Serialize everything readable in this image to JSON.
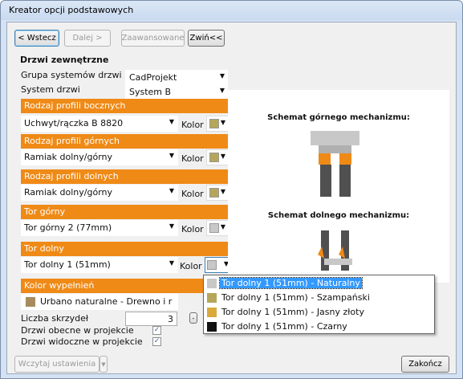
{
  "window": {
    "title": "Kreator opcji podstawowych"
  },
  "toolbar": {
    "back_label": "< Wstecz",
    "next_label": "Dalej >",
    "advanced_label": "Zaawansowane",
    "collapse_label": "Zwiń<<"
  },
  "section": {
    "title": "Drzwi zewnętrzne"
  },
  "fields": {
    "group_label": "Grupa systemów drzwi",
    "group_value": "CadProjekt",
    "system_label": "System drzwi",
    "system_value": "System B"
  },
  "profiles": [
    {
      "header": "Rodzaj profili bocznych",
      "value": "Uchwyt/rączka B 8820",
      "color_label": "Kolor",
      "swatch": "#b5a65a"
    },
    {
      "header": "Rodzaj profili górnych",
      "value": "Ramiak dolny/górny",
      "color_label": "Kolor",
      "swatch": "#b5a65a"
    },
    {
      "header": "Rodzaj profili dolnych",
      "value": "Ramiak dolny/górny",
      "color_label": "Kolor",
      "swatch": "#b5a65a"
    },
    {
      "header": "Tor górny",
      "value": "Tor górny 2 (77mm)",
      "color_label": "Kolor",
      "swatch": "#c8c8c8"
    },
    {
      "header": "Tor dolny",
      "value": "Tor dolny 1 (51mm)",
      "color_label": "Kolor",
      "swatch": "#c8c8c8"
    }
  ],
  "fill": {
    "header": "Kolor wypełnień",
    "value": "Urbano naturalne - Drewno i r",
    "swatch": "#a88a5c"
  },
  "counts": {
    "wings_label": "Liczba skrzydeł",
    "wings_value": "3",
    "in_project_label": "Drzwi obecne w projekcie",
    "in_project_checked": "✓",
    "visible_label": "Drzwi widoczne w projekcie",
    "visible_checked": "✓"
  },
  "diagram": {
    "top_title": "Schemat górnego mechanizmu:",
    "bottom_title": "Schemat dolnego mechanizmu:"
  },
  "dropdown": {
    "items": [
      {
        "label": "Tor dolny 1 (51mm) - Naturalny",
        "swatch": "#c8c8c8",
        "selected": true
      },
      {
        "label": "Tor dolny 1 (51mm) - Szampański",
        "swatch": "#b5a65a",
        "selected": false
      },
      {
        "label": "Tor dolny 1 (51mm) - Jasny złoty",
        "swatch": "#d9a93a",
        "selected": false
      },
      {
        "label": "Tor dolny 1 (51mm) - Czarny",
        "swatch": "#111111",
        "selected": false
      }
    ]
  },
  "footer": {
    "load_label": "Wczytaj ustawienia",
    "finish_label": "Zakończ"
  },
  "colors": {
    "accent": "#ef8a17",
    "highlight": "#3399ff"
  }
}
